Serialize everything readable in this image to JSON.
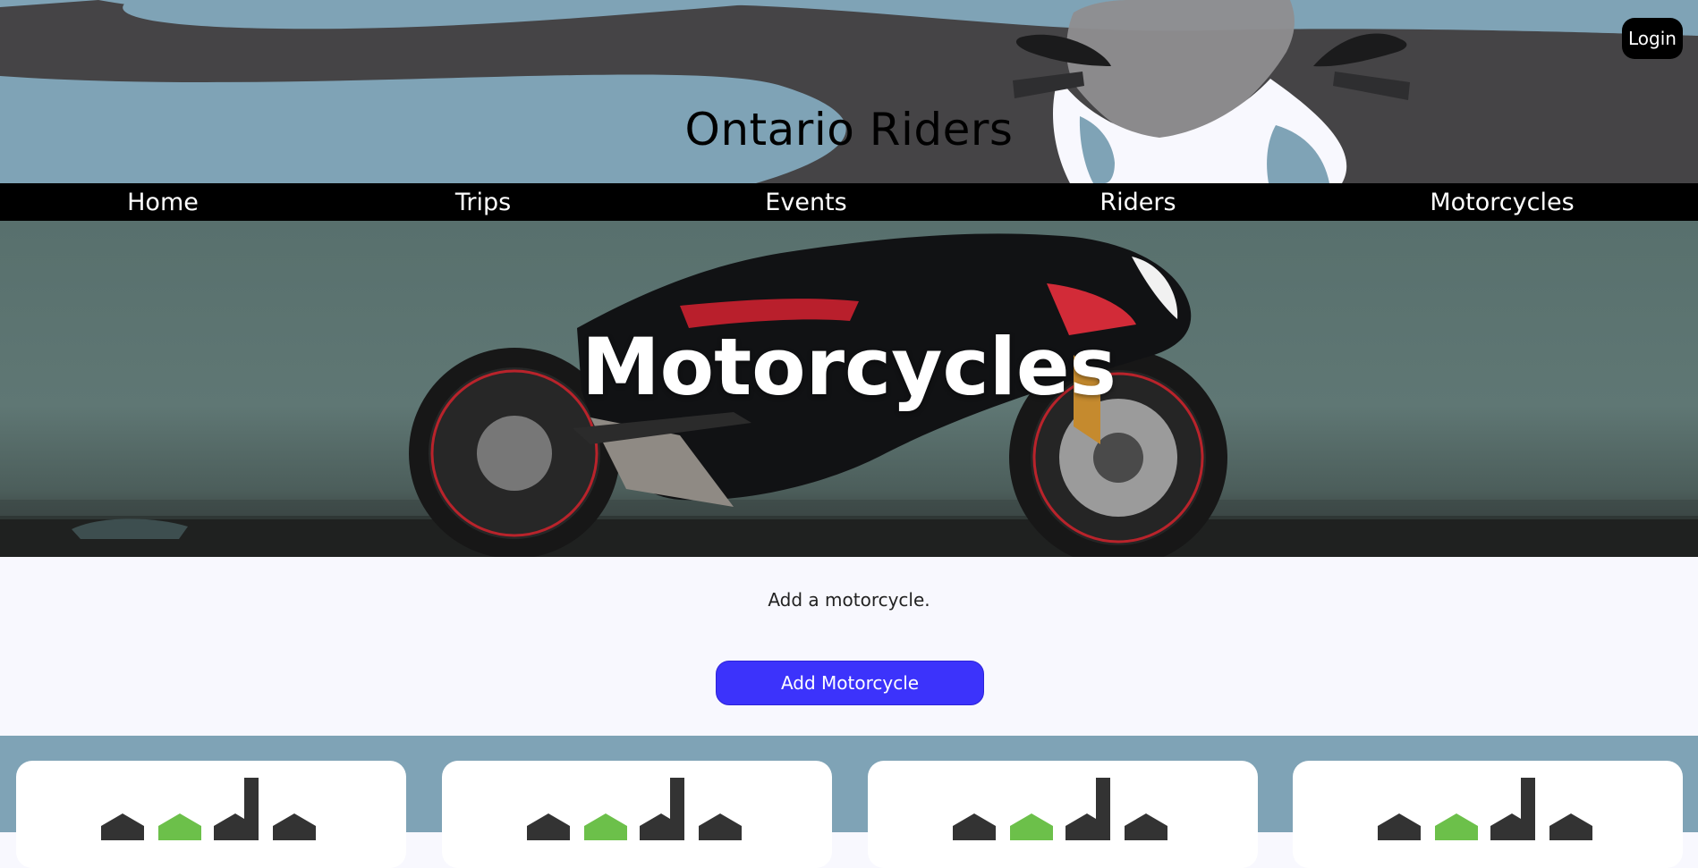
{
  "header": {
    "site_title": "Ontario Riders",
    "login_label": "Login"
  },
  "nav": {
    "items": [
      {
        "label": "Home"
      },
      {
        "label": "Trips"
      },
      {
        "label": "Events"
      },
      {
        "label": "Riders"
      },
      {
        "label": "Motorcycles"
      }
    ]
  },
  "hero": {
    "title": "Motorcycles"
  },
  "content": {
    "add_text": "Add a motorcycle.",
    "add_button_label": "Add Motorcycle"
  },
  "cards": {
    "logo_icon": "node-logo-icon"
  },
  "colors": {
    "header_bg": "#7fa3b6",
    "nav_bg": "#000000",
    "button_accent": "#3c33fb",
    "page_bg": "#f8f8fe"
  }
}
